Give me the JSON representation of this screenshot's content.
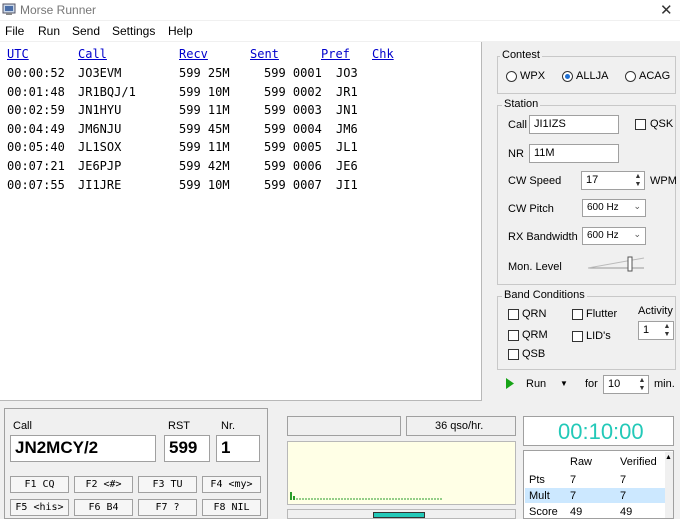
{
  "app": {
    "title": "Morse Runner"
  },
  "menu": [
    "File",
    "Run",
    "Send",
    "Settings",
    "Help"
  ],
  "log": {
    "headers": {
      "utc": "UTC",
      "call": "Call",
      "recv": "Recv",
      "sent": "Sent",
      "pref": "Pref",
      "chk": "Chk"
    },
    "rows": [
      {
        "utc": "00:00:52",
        "call": "JO3EVM",
        "recv": "599 25M",
        "sent": "599 0001",
        "pref": "JO3"
      },
      {
        "utc": "00:01:48",
        "call": "JR1BQJ/1",
        "recv": "599 10M",
        "sent": "599 0002",
        "pref": "JR1"
      },
      {
        "utc": "00:02:59",
        "call": "JN1HYU",
        "recv": "599 11M",
        "sent": "599 0003",
        "pref": "JN1"
      },
      {
        "utc": "00:04:49",
        "call": "JM6NJU",
        "recv": "599 45M",
        "sent": "599 0004",
        "pref": "JM6"
      },
      {
        "utc": "00:05:40",
        "call": "JL1SOX",
        "recv": "599 11M",
        "sent": "599 0005",
        "pref": "JL1"
      },
      {
        "utc": "00:07:21",
        "call": "JE6PJP",
        "recv": "599 42M",
        "sent": "599 0006",
        "pref": "JE6"
      },
      {
        "utc": "00:07:55",
        "call": "JI1JRE",
        "recv": "599 10M",
        "sent": "599 0007",
        "pref": "JI1"
      }
    ]
  },
  "contest": {
    "title": "Contest",
    "options": [
      "WPX",
      "ALLJA",
      "ACAG"
    ],
    "selected": "ALLJA"
  },
  "station": {
    "title": "Station",
    "call_label": "Call",
    "call_value": "JI1IZS",
    "qsk_label": "QSK",
    "nr_label": "NR",
    "nr_value": "11M",
    "cw_speed_label": "CW Speed",
    "cw_speed_value": "17",
    "wpm_label": "WPM",
    "cw_pitch_label": "CW Pitch",
    "cw_pitch_value": "600 Hz",
    "rx_bw_label": "RX Bandwidth",
    "rx_bw_value": "600 Hz",
    "mon_level_label": "Mon. Level",
    "mon_level": 0.75
  },
  "band": {
    "title": "Band Conditions",
    "qrn": "QRN",
    "flutter": "Flutter",
    "qrm": "QRM",
    "lids": "LID's",
    "qsb": "QSB",
    "activity_label": "Activity",
    "activity_value": "1"
  },
  "run": {
    "label": "Run",
    "for_label": "for",
    "minutes": "10",
    "min_label": "min."
  },
  "entry": {
    "call_label": "Call",
    "call_value": "JN2MCY/2",
    "rst_label": "RST",
    "rst_value": "599",
    "nr_label": "Nr.",
    "nr_value": "1"
  },
  "fkeys": [
    "F1 CQ",
    "F2 <#>",
    "F3 TU",
    "F4 <my>",
    "F5 <his>",
    "F6 B4",
    "F7 ?",
    "F8 NIL"
  ],
  "rate": "36 qso/hr.",
  "timer": "00:10:00",
  "colors": {
    "timer": "#23c9b8",
    "log_header": "#0000cc",
    "waterfall_bg": "#ffffe6",
    "run_icon": "#16a316"
  },
  "score": {
    "headers": [
      "",
      "Raw",
      "Verified"
    ],
    "rows": [
      {
        "label": "Pts",
        "raw": "7",
        "verified": "7"
      },
      {
        "label": "Mult",
        "raw": "7",
        "verified": "7"
      },
      {
        "label": "Score",
        "raw": "49",
        "verified": "49"
      }
    ]
  }
}
